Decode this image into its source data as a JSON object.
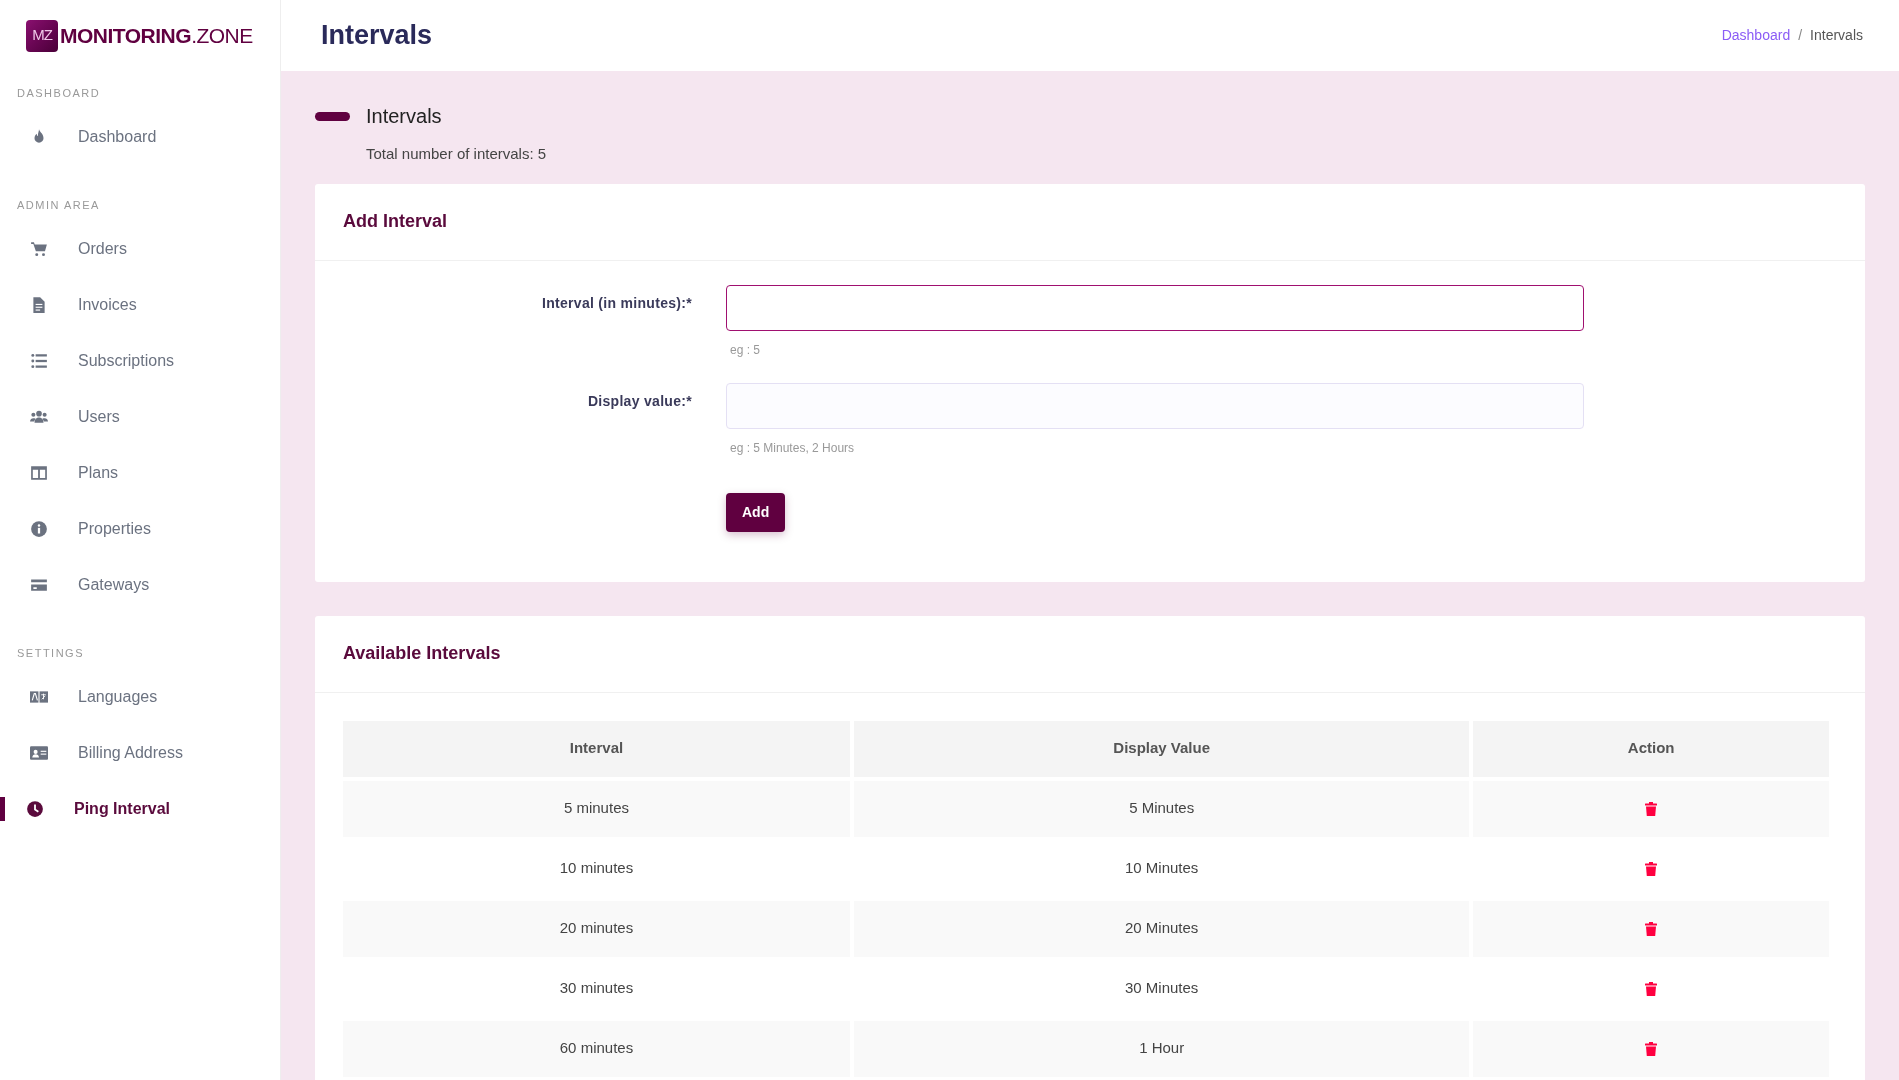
{
  "brand": {
    "mark": "MZ",
    "name": "MONITORING",
    "suffix": ".ZONE"
  },
  "sidebar": {
    "sections": [
      {
        "title": "DASHBOARD",
        "items": [
          {
            "label": "Dashboard",
            "selected": false
          }
        ]
      },
      {
        "title": "ADMIN AREA",
        "items": [
          {
            "label": "Orders",
            "selected": false
          },
          {
            "label": "Invoices",
            "selected": false
          },
          {
            "label": "Subscriptions",
            "selected": false
          },
          {
            "label": "Users",
            "selected": false
          },
          {
            "label": "Plans",
            "selected": false
          },
          {
            "label": "Properties",
            "selected": false
          },
          {
            "label": "Gateways",
            "selected": false
          }
        ]
      },
      {
        "title": "SETTINGS",
        "items": [
          {
            "label": "Languages",
            "selected": false
          },
          {
            "label": "Billing Address",
            "selected": false
          },
          {
            "label": "Ping Interval",
            "selected": true
          }
        ]
      }
    ]
  },
  "header": {
    "title": "Intervals",
    "breadcrumb": {
      "link": "Dashboard",
      "separator": "/",
      "current": "Intervals"
    }
  },
  "page": {
    "title": "Intervals",
    "subtitle": "Total number of intervals: 5"
  },
  "add_card": {
    "title": "Add Interval",
    "fields": [
      {
        "label": "Interval (in minutes):*",
        "hint": "eg : 5",
        "focused": true
      },
      {
        "label": "Display value:*",
        "hint": "eg : 5 Minutes, 2 Hours",
        "focused": false
      }
    ],
    "button": "Add"
  },
  "table_card": {
    "title": "Available Intervals",
    "columns": [
      "Interval",
      "Display Value",
      "Action"
    ],
    "rows": [
      {
        "interval": "5 minutes",
        "display": "5 Minutes"
      },
      {
        "interval": "10 minutes",
        "display": "10 Minutes"
      },
      {
        "interval": "20 minutes",
        "display": "20 Minutes"
      },
      {
        "interval": "30 minutes",
        "display": "30 Minutes"
      },
      {
        "interval": "60 minutes",
        "display": "1 Hour"
      }
    ]
  }
}
